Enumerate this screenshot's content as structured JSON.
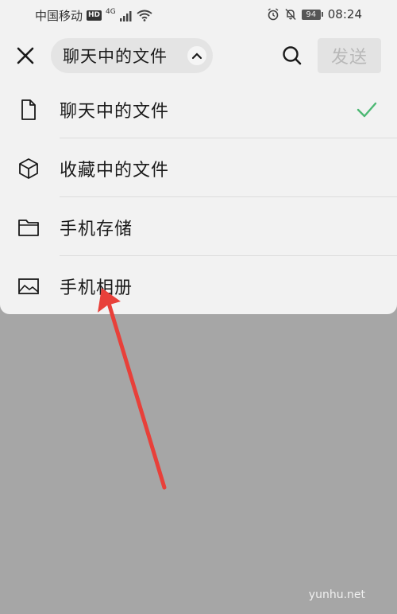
{
  "statusbar": {
    "carrier": "中国移动",
    "hd": "HD",
    "network": "4G",
    "battery": "94",
    "time": "08:24"
  },
  "topbar": {
    "close_icon": "close-icon",
    "selector_label": "聊天中的文件",
    "selector_icon": "chevron-up-icon",
    "search_icon": "search-icon",
    "send_label": "发送"
  },
  "menu": {
    "items": [
      {
        "label": "聊天中的文件",
        "icon": "file-icon",
        "selected": true
      },
      {
        "label": "收藏中的文件",
        "icon": "cube-icon",
        "selected": false
      },
      {
        "label": "手机存储",
        "icon": "folder-icon",
        "selected": false
      },
      {
        "label": "手机相册",
        "icon": "image-icon",
        "selected": false
      }
    ]
  },
  "colors": {
    "overlay": "#a6a6a6",
    "sheet": "#f2f2f2",
    "check": "#4cb873",
    "arrow": "#e8403a"
  },
  "watermark": "yunhu.net"
}
